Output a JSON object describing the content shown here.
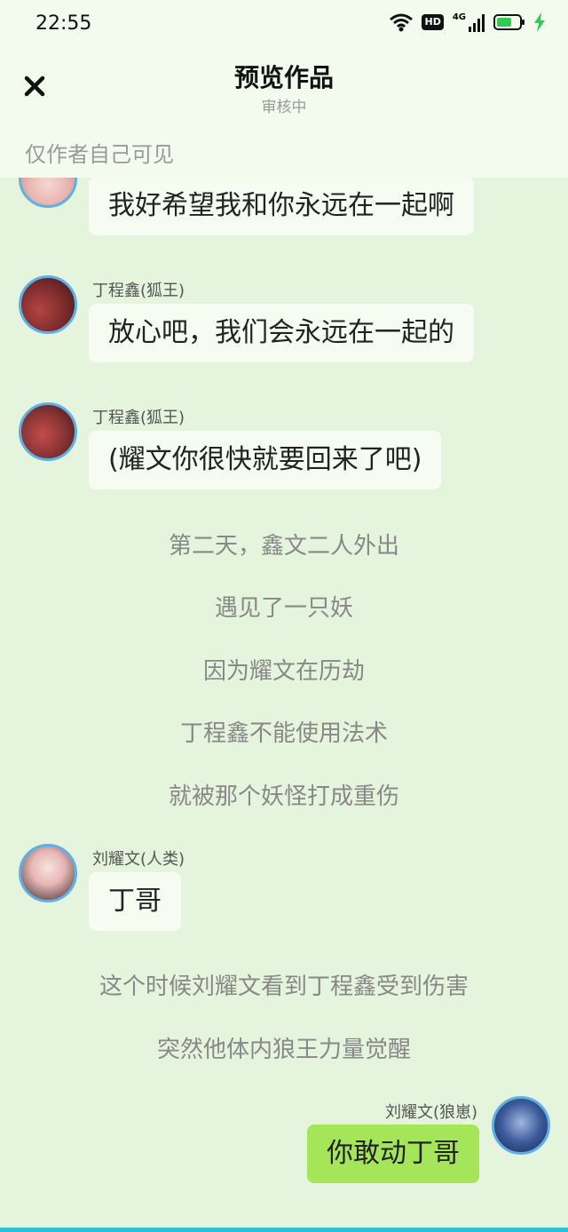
{
  "status_bar": {
    "time": "22:55",
    "hd_badge": "HD",
    "network": "4G",
    "icons": [
      "wifi-icon",
      "signal-icon",
      "battery-icon",
      "charging-icon"
    ]
  },
  "header": {
    "title": "预览作品",
    "subtitle": "审核中",
    "visibility": "仅作者自己可见"
  },
  "messages": [
    {
      "type": "bubble",
      "side": "left",
      "sender": "",
      "text": "我好希望我和你永远在一起啊"
    },
    {
      "type": "bubble",
      "side": "left",
      "sender": "丁程鑫(狐王)",
      "text": "放心吧，我们会永远在一起的"
    },
    {
      "type": "bubble",
      "side": "left",
      "sender": "丁程鑫(狐王)",
      "text": "(耀文你很快就要回来了吧)"
    },
    {
      "type": "narration",
      "text": "第二天，鑫文二人外出"
    },
    {
      "type": "narration",
      "text": "遇见了一只妖"
    },
    {
      "type": "narration",
      "text": "因为耀文在历劫"
    },
    {
      "type": "narration",
      "text": "丁程鑫不能使用法术"
    },
    {
      "type": "narration",
      "text": "就被那个妖怪打成重伤"
    },
    {
      "type": "bubble",
      "side": "left",
      "sender": "刘耀文(人类)",
      "text": "丁哥"
    },
    {
      "type": "narration",
      "text": "这个时候刘耀文看到丁程鑫受到伤害"
    },
    {
      "type": "narration",
      "text": "突然他体内狼王力量觉醒"
    },
    {
      "type": "bubble",
      "side": "right",
      "sender": "刘耀文(狼崽)",
      "text": "你敢动丁哥"
    }
  ],
  "colors": {
    "background": "#e5f4dc",
    "header_bg": "#f3fbee",
    "bubble_left": "#f6fcf2",
    "bubble_right": "#a4e559",
    "avatar_ring": "#5fb0e8",
    "accent_bar": "#29c2d6"
  }
}
